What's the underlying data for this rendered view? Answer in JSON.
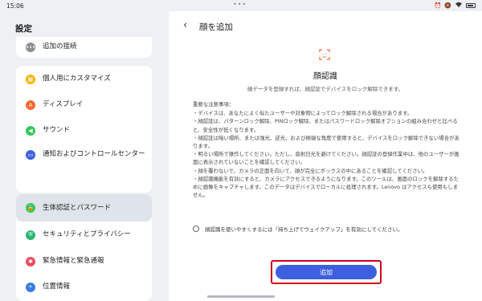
{
  "status_bar": {
    "time": "15:06",
    "dots": "•••",
    "icons": [
      "alarm-icon",
      "mute-icon",
      "wifi-icon",
      "battery-icon"
    ]
  },
  "settings": {
    "title": "設定",
    "items": [
      {
        "label": "追加の接続",
        "icon": "more-icon",
        "color": "#8e8e93"
      },
      {
        "label": "個人用にカスタマイズ",
        "icon": "palette-icon",
        "color": "#f5b400"
      },
      {
        "label": "ディスプレイ",
        "icon": "display-icon",
        "color": "#f26a2e"
      },
      {
        "label": "サウンド",
        "icon": "sound-icon",
        "color": "#34c759"
      },
      {
        "label": "通知およびコントロールセンター",
        "icon": "notification-icon",
        "color": "#3d5fe0"
      },
      {
        "label": "生体認証とパスワード",
        "icon": "lock-icon",
        "color": "#34c759"
      },
      {
        "label": "セキュリティとプライバシー",
        "icon": "shield-icon",
        "color": "#2bb673"
      },
      {
        "label": "緊急情報と緊急通報",
        "icon": "emergency-icon",
        "color": "#e94d63"
      },
      {
        "label": "位置情報",
        "icon": "location-icon",
        "color": "#3d7be0"
      }
    ]
  },
  "face_page": {
    "title": "顔を追加",
    "feature_title": "顔認識",
    "feature_desc": "顔データを登録すれば、顔認証でデバイスをロック解除できます。",
    "notes_heading": "重要な注意事項：",
    "notes": [
      "・デバイスは、あなたによく似たユーザーや対象物によってロック解除される場合があります。",
      "・顔認証は、パターンロック解除、PINロック解除、またはパスワードロック解除オプションの組み合わせと比べると、安全性が低くなります。",
      "・顔認証は暗い場所、または強光、逆光、および極端な角度で使用すると、デバイスをロック解除できない場合があります。",
      "・明るい場所で操作してください。ただし、直射日光を避けてください。顔認証の登録作業中は、他のユーザーが画面に表示されていないことを確認してください。",
      "・顔を覆わないで、カメラの正面を向いて、顔が完全にボックスの中にあることを確認してください。",
      "・顔認識機能を有効にすると、カメラにアクセスできるようになります。このツールは、画面のロックを解除するために画像をキャプチャします。このデータはデバイスでローカルに処理されます。Lenovo はアクセスも使用もしません。"
    ],
    "checkbox_label": "顔認識を使いやすくするには「持ち上げてウェイクアップ」を有効にしてください。",
    "add_button": "追加",
    "accent_color": "#3d5fe0",
    "highlight_color": "#d0021b"
  }
}
